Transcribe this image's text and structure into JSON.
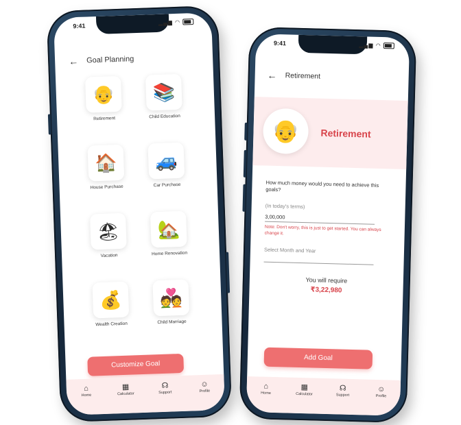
{
  "phone1": {
    "status_time": "9:41",
    "title": "Goal Planning",
    "goals": [
      {
        "label": "Retirement",
        "icon": "👴"
      },
      {
        "label": "Child Education",
        "icon": "📚"
      },
      {
        "label": "House Purchase",
        "icon": "🏠"
      },
      {
        "label": "Car Purchase",
        "icon": "🚙"
      },
      {
        "label": "Vacation",
        "icon": "🏖"
      },
      {
        "label": "Home Renovation",
        "icon": "🏡"
      },
      {
        "label": "Wealth Creation",
        "icon": "💰"
      },
      {
        "label": "Child Marriage",
        "icon": "💑"
      }
    ],
    "cta_label": "Customize Goal",
    "tabs": [
      {
        "label": "Home",
        "icon": "home-icon"
      },
      {
        "label": "Calculator",
        "icon": "calculator-icon"
      },
      {
        "label": "Support",
        "icon": "support-icon"
      },
      {
        "label": "Profile",
        "icon": "profile-icon"
      }
    ]
  },
  "phone2": {
    "status_time": "9:41",
    "title": "Retirement",
    "hero_title": "Retirement",
    "question": "How much money would you need to achieve this goals?",
    "amount_hint": "(In today's terms)",
    "amount_value": "3,00,000",
    "note": "Note: Don't worry, this is just to get started. You can always change it.",
    "date_placeholder": "Select Month and Year",
    "require_label": "You will require",
    "require_value": "₹3,22,980",
    "cta_label": "Add Goal",
    "tabs": [
      {
        "label": "Home",
        "icon": "home-icon"
      },
      {
        "label": "Calculator",
        "icon": "calculator-icon"
      },
      {
        "label": "Support",
        "icon": "support-icon"
      },
      {
        "label": "Profile",
        "icon": "profile-icon"
      }
    ]
  },
  "colors": {
    "accent": "#ee6f70",
    "accent_text": "#d8434a",
    "tabbar_bg": "#fdecec",
    "frame": "#1e3650"
  }
}
